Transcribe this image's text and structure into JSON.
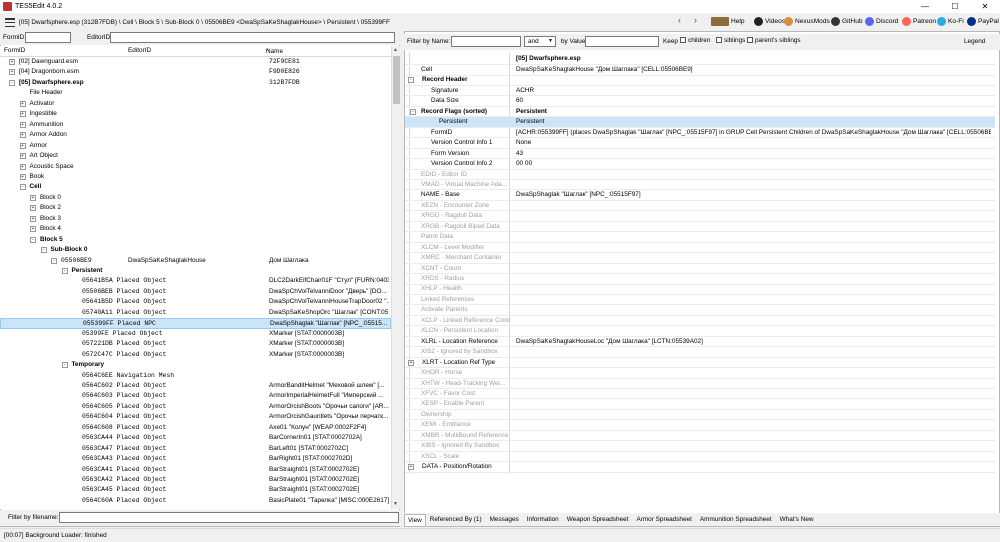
{
  "window": {
    "title": "TES5Edit 4.0.2"
  },
  "pathbar": {
    "path": "[05] Dwarfsphere.esp (312B7FDB) \\ Cell \\ Block 5 \\ Sub-Block 0 \\ 05506BE9 <DwaSpSaKeShaglakHouse> \\ Persistent \\ 055399FF"
  },
  "toolbar": [
    {
      "icon": "help-book-icon",
      "label": "Help",
      "color": "#8a6d3b"
    },
    {
      "icon": "videos-icon",
      "label": "Videos",
      "color": "#222222"
    },
    {
      "icon": "nexusmods-icon",
      "label": "NexusMods",
      "color": "#d98f40"
    },
    {
      "icon": "github-icon",
      "label": "GitHub",
      "color": "#333333"
    },
    {
      "icon": "discord-icon",
      "label": "Discord",
      "color": "#5865f2"
    },
    {
      "icon": "patreon-icon",
      "label": "Patreon",
      "color": "#f96854"
    },
    {
      "icon": "kofi-icon",
      "label": "Ko-Fi",
      "color": "#29abe0"
    },
    {
      "icon": "paypal-icon",
      "label": "PayPal",
      "color": "#003087"
    }
  ],
  "left": {
    "formid_label": "FormID",
    "editorid_label": "EditorID",
    "columns": {
      "formid": "FormID",
      "editorid": "EditorID",
      "name": "Name"
    },
    "sort_glyph": "^",
    "filter_label": "Filter by filename:",
    "rows": [
      {
        "indent": 0,
        "exp": "+",
        "c1": "[02] Dawnguard.esm",
        "c2": "",
        "c3": "72F9CE81",
        "bold": false,
        "mono1": false,
        "mono3": true
      },
      {
        "indent": 0,
        "exp": "+",
        "c1": "[04] Dragonborn.esm",
        "c2": "",
        "c3": "F9D0E826",
        "bold": false,
        "mono1": false,
        "mono3": true
      },
      {
        "indent": 0,
        "exp": "-",
        "c1": "[05] Dwarfsphere.esp",
        "c2": "",
        "c3": "312B7FDB",
        "bold": true,
        "mono1": false,
        "mono3": true
      },
      {
        "indent": 1,
        "exp": "",
        "c1": "File Header",
        "c2": "",
        "c3": "",
        "bold": false
      },
      {
        "indent": 1,
        "exp": "+",
        "c1": "Activator",
        "c2": "",
        "c3": "",
        "bold": false
      },
      {
        "indent": 1,
        "exp": "+",
        "c1": "Ingestible",
        "c2": "",
        "c3": "",
        "bold": false
      },
      {
        "indent": 1,
        "exp": "+",
        "c1": "Ammunition",
        "c2": "",
        "c3": "",
        "bold": false
      },
      {
        "indent": 1,
        "exp": "+",
        "c1": "Armor Addon",
        "c2": "",
        "c3": "",
        "bold": false
      },
      {
        "indent": 1,
        "exp": "+",
        "c1": "Armor",
        "c2": "",
        "c3": "",
        "bold": false
      },
      {
        "indent": 1,
        "exp": "+",
        "c1": "Art Object",
        "c2": "",
        "c3": "",
        "bold": false
      },
      {
        "indent": 1,
        "exp": "+",
        "c1": "Acoustic Space",
        "c2": "",
        "c3": "",
        "bold": false
      },
      {
        "indent": 1,
        "exp": "+",
        "c1": "Book",
        "c2": "",
        "c3": "",
        "bold": false
      },
      {
        "indent": 1,
        "exp": "-",
        "c1": "Cell",
        "c2": "",
        "c3": "",
        "bold": true
      },
      {
        "indent": 2,
        "exp": "+",
        "c1": "Block 0",
        "c2": "",
        "c3": "",
        "bold": false
      },
      {
        "indent": 2,
        "exp": "+",
        "c1": "Block 2",
        "c2": "",
        "c3": "",
        "bold": false
      },
      {
        "indent": 2,
        "exp": "+",
        "c1": "Block 3",
        "c2": "",
        "c3": "",
        "bold": false
      },
      {
        "indent": 2,
        "exp": "+",
        "c1": "Block 4",
        "c2": "",
        "c3": "",
        "bold": false
      },
      {
        "indent": 2,
        "exp": "-",
        "c1": "Block 5",
        "c2": "",
        "c3": "",
        "bold": true
      },
      {
        "indent": 3,
        "exp": "-",
        "c1": "Sub-Block 0",
        "c2": "",
        "c3": "",
        "bold": true
      },
      {
        "indent": 4,
        "exp": "-",
        "c1": "05506BE9",
        "c2": "DwaSpSaKeShaglakHouse",
        "c3": "Дом Шаглака",
        "bold": false,
        "mono1": true
      },
      {
        "indent": 5,
        "exp": "-",
        "c1": "Persistent",
        "c2": "",
        "c3": "",
        "bold": true
      },
      {
        "indent": 6,
        "exp": "",
        "c1": "05641B5A  Placed Object",
        "c2": "",
        "c3": "DLC2DarkElfChair01F \"Стул\" [FURN:0403...",
        "bold": false,
        "mono1": true
      },
      {
        "indent": 6,
        "exp": "",
        "c1": "05506BEB  Placed Object",
        "c2": "",
        "c3": "DwaSpChVolTelvanniDoor \"Дверь\" [DO...",
        "bold": false,
        "mono1": true
      },
      {
        "indent": 6,
        "exp": "",
        "c1": "05641B5D  Placed Object",
        "c2": "",
        "c3": "DwaSpChVolTelvanniHouseTrapDoor02 \"...",
        "bold": false,
        "mono1": true
      },
      {
        "indent": 6,
        "exp": "",
        "c1": "05740A11  Placed Object",
        "c2": "",
        "c3": "DwaSpSaKeShopOrc \"Шаглак\" [CONT:05...",
        "bold": false,
        "mono1": true
      },
      {
        "indent": 6,
        "exp": "",
        "c1": "055399FF  Placed NPC",
        "c2": "",
        "c3": "DwaSpShaglak \"Шаглак\" [NPC_:05515...",
        "bold": false,
        "mono1": true,
        "selected": true
      },
      {
        "indent": 6,
        "exp": "",
        "c1": "05399FE  Placed Object",
        "c2": "",
        "c3": "XMarker [STAT:0000003B]",
        "bold": false,
        "mono1": true
      },
      {
        "indent": 6,
        "exp": "",
        "c1": "057221DB  Placed Object",
        "c2": "",
        "c3": "XMarker [STAT:0000003B]",
        "bold": false,
        "mono1": true
      },
      {
        "indent": 6,
        "exp": "",
        "c1": "0572C47C  Placed Object",
        "c2": "",
        "c3": "XMarker [STAT:0000003B]",
        "bold": false,
        "mono1": true
      },
      {
        "indent": 5,
        "exp": "-",
        "c1": "Temporary",
        "c2": "",
        "c3": "",
        "bold": true
      },
      {
        "indent": 6,
        "exp": "",
        "c1": "0564C6EE  Navigation Mesh",
        "c2": "",
        "c3": "",
        "bold": false,
        "mono1": true
      },
      {
        "indent": 6,
        "exp": "",
        "c1": "0564C602  Placed Object",
        "c2": "",
        "c3": "ArmorBanditHelmet \"Меховой шлем\" [...",
        "bold": false,
        "mono1": true
      },
      {
        "indent": 6,
        "exp": "",
        "c1": "0564C603  Placed Object",
        "c2": "",
        "c3": "ArmorImperialHelmetFull \"Имперский ...",
        "bold": false,
        "mono1": true
      },
      {
        "indent": 6,
        "exp": "",
        "c1": "0564C605  Placed Object",
        "c2": "",
        "c3": "ArmorOrcishBoots \"Орочьи сапоги\" [AR...",
        "bold": false,
        "mono1": true
      },
      {
        "indent": 6,
        "exp": "",
        "c1": "0564C604  Placed Object",
        "c2": "",
        "c3": "ArmorOrcishGauntlets \"Орочьи перчатк...",
        "bold": false,
        "mono1": true
      },
      {
        "indent": 6,
        "exp": "",
        "c1": "0564C608  Placed Object",
        "c2": "",
        "c3": "Axe01 \"Колун\" [WEAP:0002F2F4]",
        "bold": false,
        "mono1": true
      },
      {
        "indent": 6,
        "exp": "",
        "c1": "0563CA44  Placed Object",
        "c2": "",
        "c3": "BarCornerIn01 [STAT:0002702A]",
        "bold": false,
        "mono1": true
      },
      {
        "indent": 6,
        "exp": "",
        "c1": "0563CA47  Placed Object",
        "c2": "",
        "c3": "BarLeft01 [STAT:0002702C]",
        "bold": false,
        "mono1": true
      },
      {
        "indent": 6,
        "exp": "",
        "c1": "0563CA43  Placed Object",
        "c2": "",
        "c3": "BarRight01 [STAT:0002702D]",
        "bold": false,
        "mono1": true
      },
      {
        "indent": 6,
        "exp": "",
        "c1": "0563CA41  Placed Object",
        "c2": "",
        "c3": "BarStraight01 [STAT:0002702E]",
        "bold": false,
        "mono1": true
      },
      {
        "indent": 6,
        "exp": "",
        "c1": "0563CA42  Placed Object",
        "c2": "",
        "c3": "BarStraight01 [STAT:0002702E]",
        "bold": false,
        "mono1": true
      },
      {
        "indent": 6,
        "exp": "",
        "c1": "0563CA45  Placed Object",
        "c2": "",
        "c3": "BarStraight01 [STAT:0002702E]",
        "bold": false,
        "mono1": true
      },
      {
        "indent": 6,
        "exp": "",
        "c1": "0564C60A  Placed Object",
        "c2": "",
        "c3": "BasicPlate01 \"Тарелка\" [MISC:000E2617]",
        "bold": false,
        "mono1": true
      }
    ]
  },
  "right": {
    "filter": {
      "name_label": "Filter by Name:",
      "and_value": "and",
      "value_label": "by Value:",
      "keep_label": "Keep",
      "children_label": "children",
      "siblings_label": "siblings",
      "parents_siblings_label": "parent's siblings",
      "legend_label": "Legend"
    },
    "header_value": "[05] Dwarfsphere.esp",
    "rows": [
      {
        "level": 1,
        "exp": "",
        "key": "Cell",
        "value": "DwaSpSaKeShaglakHouse \"Дом Шаглака\" [CELL:05506BE9]",
        "gray": false,
        "bold": false
      },
      {
        "level": 0,
        "exp": "-",
        "key": "Record Header",
        "value": "",
        "gray": false,
        "bold": true
      },
      {
        "level": 2,
        "exp": "",
        "key": "Signature",
        "value": "ACHR",
        "gray": false,
        "bold": false
      },
      {
        "level": 2,
        "exp": "",
        "key": "Data Size",
        "value": "60",
        "gray": false,
        "bold": false
      },
      {
        "level": 1,
        "exp": "-",
        "key": "Record Flags (sorted)",
        "value": "Persistent",
        "gray": false,
        "bold": true,
        "bold_value": true
      },
      {
        "level": 3,
        "exp": "",
        "key": "Persistent",
        "value": "Persistent",
        "gray": false,
        "bold": false,
        "hl": true
      },
      {
        "level": 2,
        "exp": "",
        "key": "FormID",
        "value": "[ACHR:055399FF] (places DwaSpShaglak \"Шаглак\" [NPC_:05515F97] in GRUP Cell Persistent Children of DwaSpSaKeShaglakHouse \"Дом Шаглака\" [CELL:05506BE9])",
        "gray": false,
        "bold": false
      },
      {
        "level": 2,
        "exp": "",
        "key": "Version Control Info 1",
        "value": "None",
        "gray": false,
        "bold": false
      },
      {
        "level": 2,
        "exp": "",
        "key": "Form Version",
        "value": "43",
        "gray": false,
        "bold": false
      },
      {
        "level": 2,
        "exp": "",
        "key": "Version Control Info 2",
        "value": "00 00",
        "gray": false,
        "bold": false
      },
      {
        "level": 1,
        "exp": "",
        "key": "EDID - Editor ID",
        "value": "",
        "gray": true
      },
      {
        "level": 1,
        "exp": "",
        "key": "VMAD - Virtual Machine Ada...",
        "value": "",
        "gray": true
      },
      {
        "level": 1,
        "exp": "",
        "key": "NAME - Base",
        "value": "DwaSpShaglak \"Шаглак\" [NPC_:05515F97]",
        "gray": false,
        "bold": false
      },
      {
        "level": 1,
        "exp": "",
        "key": "XEZN - Encounter Zone",
        "value": "",
        "gray": true
      },
      {
        "level": 1,
        "exp": "",
        "key": "XRGD - Ragdoll Data",
        "value": "",
        "gray": true
      },
      {
        "level": 1,
        "exp": "",
        "key": "XRGB - Ragdoll Biped Data",
        "value": "",
        "gray": true
      },
      {
        "level": 1,
        "exp": "",
        "key": "Patrol Data",
        "value": "",
        "gray": true
      },
      {
        "level": 1,
        "exp": "",
        "key": "XLCM - Level Modifier",
        "value": "",
        "gray": true
      },
      {
        "level": 1,
        "exp": "",
        "key": "XMRC - Merchant Container",
        "value": "",
        "gray": true
      },
      {
        "level": 1,
        "exp": "",
        "key": "XCNT - Count",
        "value": "",
        "gray": true
      },
      {
        "level": 1,
        "exp": "",
        "key": "XRDS - Radius",
        "value": "",
        "gray": true
      },
      {
        "level": 1,
        "exp": "",
        "key": "XHLP - Health",
        "value": "",
        "gray": true
      },
      {
        "level": 1,
        "exp": "",
        "key": "Linked References",
        "value": "",
        "gray": true
      },
      {
        "level": 1,
        "exp": "",
        "key": "Activate Parents",
        "value": "",
        "gray": true
      },
      {
        "level": 1,
        "exp": "",
        "key": "XCLP - Linked Reference Color",
        "value": "",
        "gray": true
      },
      {
        "level": 1,
        "exp": "",
        "key": "XLCN - Persistent Location",
        "value": "",
        "gray": true
      },
      {
        "level": 1,
        "exp": "",
        "key": "XLRL - Location Reference",
        "value": "DwaSpSaKeShaglakHouseLoc \"Дом Шаглака\" [LCTN:05539A02]",
        "gray": false,
        "bold": false
      },
      {
        "level": 1,
        "exp": "",
        "key": "XIS2 - Ignored by Sandbox",
        "value": "",
        "gray": true
      },
      {
        "level": 0,
        "exp": "+",
        "key": "XLRT - Location Ref Type",
        "value": "",
        "gray": false,
        "bold": false
      },
      {
        "level": 1,
        "exp": "",
        "key": "XHOR - Horse",
        "value": "",
        "gray": true
      },
      {
        "level": 1,
        "exp": "",
        "key": "XHTW - Head-Tracking Wei...",
        "value": "",
        "gray": true
      },
      {
        "level": 1,
        "exp": "",
        "key": "XFVC - Favor Cost",
        "value": "",
        "gray": true
      },
      {
        "level": 1,
        "exp": "",
        "key": "XESP - Enable Parent",
        "value": "",
        "gray": true
      },
      {
        "level": 1,
        "exp": "",
        "key": "Ownership",
        "value": "",
        "gray": true
      },
      {
        "level": 1,
        "exp": "",
        "key": "XEMI - Emittance",
        "value": "",
        "gray": true
      },
      {
        "level": 1,
        "exp": "",
        "key": "XMBR - MultiBound Reference",
        "value": "",
        "gray": true
      },
      {
        "level": 1,
        "exp": "",
        "key": "XIBS - Ignored By Sandbox",
        "value": "",
        "gray": true
      },
      {
        "level": 1,
        "exp": "",
        "key": "XSCL - Scale",
        "value": "",
        "gray": true
      },
      {
        "level": 0,
        "exp": "+",
        "key": "DATA - Position/Rotation",
        "value": "",
        "gray": false,
        "bold": false
      }
    ],
    "tabs": [
      "View",
      "Referenced By (1)",
      "Messages",
      "Information",
      "Weapon Spreadsheet",
      "Armor Spreadsheet",
      "Ammunition Spreadsheet",
      "What's New"
    ],
    "active_tab": 0
  },
  "status": "[00:07] Background Loader: finished",
  "colors": {
    "selection": "#cce4f7",
    "gray_text": "#a0a0a0"
  }
}
